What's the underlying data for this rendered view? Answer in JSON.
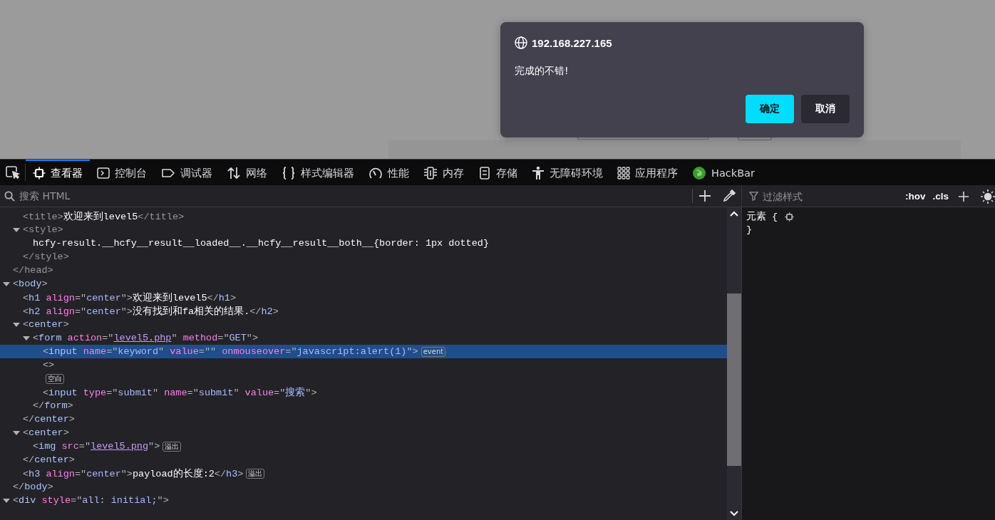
{
  "dialog": {
    "host": "192.168.227.165",
    "message": "完成的不错!",
    "buttons": [
      {
        "label": "确定",
        "kind": "primary"
      },
      {
        "label": "取消",
        "kind": "secondary"
      }
    ]
  },
  "toolbar": {
    "tabs": [
      {
        "label": "查看器",
        "kind": "inspector",
        "selected": true
      },
      {
        "label": "控制台",
        "kind": "console",
        "selected": false
      },
      {
        "label": "调试器",
        "kind": "debugger",
        "selected": false
      },
      {
        "label": "网络",
        "kind": "network",
        "selected": false
      },
      {
        "label": "样式编辑器",
        "kind": "braces",
        "selected": false
      },
      {
        "label": "性能",
        "kind": "gauge",
        "selected": false
      },
      {
        "label": "内存",
        "kind": "chip",
        "selected": false
      },
      {
        "label": "存储",
        "kind": "storage",
        "selected": false
      },
      {
        "label": "无障碍环境",
        "kind": "person",
        "selected": false
      },
      {
        "label": "应用程序",
        "kind": "grid",
        "selected": false
      },
      {
        "label": "HackBar",
        "kind": "addon",
        "selected": false
      }
    ]
  },
  "search": {
    "placeholder": "搜索 HTML"
  },
  "tree": {
    "nodes": [
      {
        "children": [
          {
            "open": [
              {
                "kind": "dim",
                "text": "<title>"
              },
              {
                "kind": "text",
                "text": "欢迎来到level5"
              },
              {
                "kind": "dim",
                "text": "</title>"
              }
            ]
          },
          {
            "expanded": true,
            "open": [
              {
                "kind": "dim",
                "text": "<style>"
              }
            ],
            "children": [
              {
                "open": [
                  {
                    "kind": "text",
                    "text": "hcfy-result.__hcfy__result__loaded__.__hcfy__result__both__{border: 1px dotted}"
                  }
                ]
              }
            ],
            "close": [
              {
                "kind": "dim",
                "text": "</style>"
              }
            ]
          }
        ],
        "close": [
          {
            "kind": "dim",
            "text": "</head>"
          }
        ]
      },
      {
        "expanded": true,
        "open": [
          {
            "kind": "punct",
            "text": "<"
          },
          {
            "kind": "tag",
            "text": "body"
          },
          {
            "kind": "punct",
            "text": ">"
          }
        ],
        "children": [
          {
            "open": [
              {
                "kind": "punct",
                "text": "<"
              },
              {
                "kind": "tag",
                "text": "h1"
              },
              {
                "kind": "attr",
                "text": " align"
              },
              {
                "kind": "punct",
                "text": "=\""
              },
              {
                "kind": "value",
                "text": "center"
              },
              {
                "kind": "punct",
                "text": "\">"
              },
              {
                "kind": "text",
                "text": "欢迎来到level5"
              },
              {
                "kind": "punct",
                "text": "</"
              },
              {
                "kind": "tag",
                "text": "h1"
              },
              {
                "kind": "punct",
                "text": ">"
              }
            ]
          },
          {
            "open": [
              {
                "kind": "punct",
                "text": "<"
              },
              {
                "kind": "tag",
                "text": "h2"
              },
              {
                "kind": "attr",
                "text": " align"
              },
              {
                "kind": "punct",
                "text": "=\""
              },
              {
                "kind": "value",
                "text": "center"
              },
              {
                "kind": "punct",
                "text": "\">"
              },
              {
                "kind": "text",
                "text": "没有找到和fa相关的结果."
              },
              {
                "kind": "punct",
                "text": "</"
              },
              {
                "kind": "tag",
                "text": "h2"
              },
              {
                "kind": "punct",
                "text": ">"
              }
            ]
          },
          {
            "expanded": true,
            "open": [
              {
                "kind": "punct",
                "text": "<"
              },
              {
                "kind": "tag",
                "text": "center"
              },
              {
                "kind": "punct",
                "text": ">"
              }
            ],
            "children": [
              {
                "expanded": true,
                "open": [
                  {
                    "kind": "punct",
                    "text": "<"
                  },
                  {
                    "kind": "tag",
                    "text": "form"
                  },
                  {
                    "kind": "attr",
                    "text": " action"
                  },
                  {
                    "kind": "punct",
                    "text": "=\""
                  },
                  {
                    "kind": "link",
                    "text": "level5.php"
                  },
                  {
                    "kind": "punct",
                    "text": "\""
                  },
                  {
                    "kind": "attr",
                    "text": " method"
                  },
                  {
                    "kind": "punct",
                    "text": "=\""
                  },
                  {
                    "kind": "value",
                    "text": "GET"
                  },
                  {
                    "kind": "punct",
                    "text": "\">"
                  }
                ],
                "children": [
                  {
                    "selected": true,
                    "badge": "event",
                    "open": [
                      {
                        "kind": "punct",
                        "text": "<"
                      },
                      {
                        "kind": "tag",
                        "text": "input"
                      },
                      {
                        "kind": "attr",
                        "text": " name"
                      },
                      {
                        "kind": "punct",
                        "text": "=\""
                      },
                      {
                        "kind": "value",
                        "text": "keyword"
                      },
                      {
                        "kind": "punct",
                        "text": "\""
                      },
                      {
                        "kind": "attr",
                        "text": " value"
                      },
                      {
                        "kind": "punct",
                        "text": "=\"\""
                      },
                      {
                        "kind": "attr",
                        "text": " onmouseover"
                      },
                      {
                        "kind": "punct",
                        "text": "=\""
                      },
                      {
                        "kind": "value",
                        "text": "javascript:alert(1)"
                      },
                      {
                        "kind": "punct",
                        "text": "\">"
                      }
                    ]
                  },
                  {
                    "selected": false,
                    "open": [
                      {
                        "kind": "punct",
                        "text": "<>"
                      }
                    ]
                  },
                  {
                    "selected": false,
                    "badge": "空白"
                  },
                  {
                    "selected": false,
                    "open": [
                      {
                        "kind": "punct",
                        "text": "<"
                      },
                      {
                        "kind": "tag",
                        "text": "input"
                      },
                      {
                        "kind": "attr",
                        "text": " type"
                      },
                      {
                        "kind": "punct",
                        "text": "=\""
                      },
                      {
                        "kind": "value",
                        "text": "submit"
                      },
                      {
                        "kind": "punct",
                        "text": "\""
                      },
                      {
                        "kind": "attr",
                        "text": " name"
                      },
                      {
                        "kind": "punct",
                        "text": "=\""
                      },
                      {
                        "kind": "value",
                        "text": "submit"
                      },
                      {
                        "kind": "punct",
                        "text": "\""
                      },
                      {
                        "kind": "attr",
                        "text": " value"
                      },
                      {
                        "kind": "punct",
                        "text": "=\""
                      },
                      {
                        "kind": "value",
                        "text": "搜索"
                      },
                      {
                        "kind": "punct",
                        "text": "\">"
                      }
                    ]
                  }
                ],
                "close": [
                  {
                    "kind": "punct",
                    "text": "</"
                  },
                  {
                    "kind": "tag",
                    "text": "form"
                  },
                  {
                    "kind": "punct",
                    "text": ">"
                  }
                ]
              }
            ],
            "close": [
              {
                "kind": "punct",
                "text": "</"
              },
              {
                "kind": "tag",
                "text": "center"
              },
              {
                "kind": "punct",
                "text": ">"
              }
            ]
          },
          {
            "expanded": true,
            "open": [
              {
                "kind": "punct",
                "text": "<"
              },
              {
                "kind": "tag",
                "text": "center"
              },
              {
                "kind": "punct",
                "text": ">"
              }
            ],
            "children": [
              {
                "badge": "溢出",
                "open": [
                  {
                    "kind": "punct",
                    "text": "<"
                  },
                  {
                    "kind": "tag",
                    "text": "img"
                  },
                  {
                    "kind": "attr",
                    "text": " src"
                  },
                  {
                    "kind": "punct",
                    "text": "=\""
                  },
                  {
                    "kind": "link",
                    "text": "level5.png"
                  },
                  {
                    "kind": "punct",
                    "text": "\">"
                  }
                ]
              }
            ],
            "close": [
              {
                "kind": "punct",
                "text": "</"
              },
              {
                "kind": "tag",
                "text": "center"
              },
              {
                "kind": "punct",
                "text": ">"
              }
            ]
          },
          {
            "badge": "溢出",
            "open": [
              {
                "kind": "punct",
                "text": "<"
              },
              {
                "kind": "tag",
                "text": "h3"
              },
              {
                "kind": "attr",
                "text": " align"
              },
              {
                "kind": "punct",
                "text": "=\""
              },
              {
                "kind": "value",
                "text": "center"
              },
              {
                "kind": "punct",
                "text": "\">"
              },
              {
                "kind": "text",
                "text": "payload的长度:2"
              },
              {
                "kind": "punct",
                "text": "</"
              },
              {
                "kind": "tag",
                "text": "h3"
              },
              {
                "kind": "punct",
                "text": ">"
              }
            ]
          }
        ],
        "close": [
          {
            "kind": "punct",
            "text": "</"
          },
          {
            "kind": "tag",
            "text": "body"
          },
          {
            "kind": "punct",
            "text": ">"
          }
        ]
      },
      {
        "expanded": true,
        "open": [
          {
            "kind": "punct",
            "text": "<"
          },
          {
            "kind": "tag",
            "text": "div"
          },
          {
            "kind": "attr",
            "text": " style"
          },
          {
            "kind": "punct",
            "text": "=\""
          },
          {
            "kind": "value",
            "text": "all: initial;"
          },
          {
            "kind": "punct",
            "text": "\">"
          }
        ]
      }
    ]
  },
  "styles": {
    "filter_placeholder": "过滤样式",
    "toggles": [
      ":hov",
      ".cls"
    ],
    "rule_open": "元素 {",
    "rule_close": "}"
  }
}
